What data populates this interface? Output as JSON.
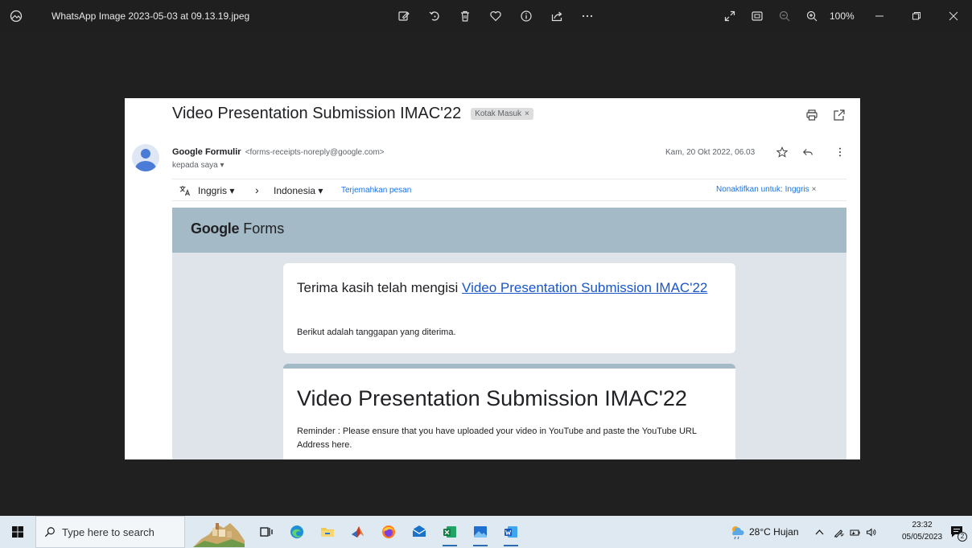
{
  "viewer": {
    "filename": "WhatsApp Image 2023-05-03 at 09.13.19.jpeg",
    "zoom": "100%",
    "tools": [
      "edit-image-icon",
      "rotate-icon",
      "delete-icon",
      "favorite-icon",
      "info-icon",
      "share-icon",
      "more-icon"
    ]
  },
  "email": {
    "subject": "Video Presentation Submission IMAC'22",
    "label": "Kotak Masuk",
    "label_close": "×",
    "sender_name": "Google Formulir",
    "sender_email": "<forms-receipts-noreply@google.com>",
    "recipient": "kepada saya ▾",
    "datetime": "Kam, 20 Okt 2022, 06.03",
    "translate": {
      "source": "Inggris ▾",
      "arrow": "›",
      "target": "Indonesia ▾",
      "action": "Terjemahkan pesan",
      "disable": "Nonaktifkan untuk: Inggris",
      "disable_close": "×"
    }
  },
  "form": {
    "logo_bold": "Google",
    "logo_rest": " Forms",
    "thanks_prefix": "Terima kasih telah mengisi ",
    "thanks_link": "Video Presentation Submission IMAC'22",
    "responses_note": "Berikut adalah tanggapan yang diterima.",
    "title": "Video Presentation Submission IMAC'22",
    "reminder": "Reminder : Please ensure that you have uploaded your video in YouTube and paste the YouTube URL Address here."
  },
  "taskbar": {
    "search_placeholder": "Type here to search",
    "weather": "28°C  Hujan",
    "time": "23:32",
    "date": "05/05/2023",
    "notification_count": "2"
  }
}
